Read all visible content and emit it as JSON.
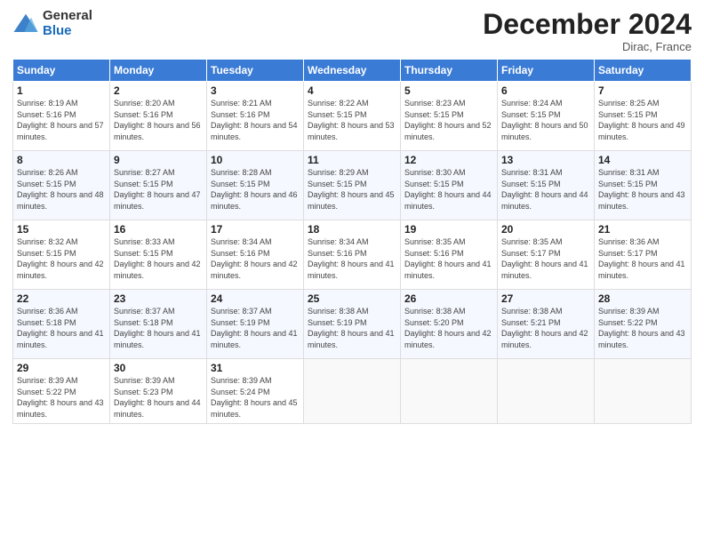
{
  "header": {
    "logo_general": "General",
    "logo_blue": "Blue",
    "month_title": "December 2024",
    "location": "Dirac, France"
  },
  "days_of_week": [
    "Sunday",
    "Monday",
    "Tuesday",
    "Wednesday",
    "Thursday",
    "Friday",
    "Saturday"
  ],
  "weeks": [
    [
      {
        "day": "1",
        "sunrise": "8:19 AM",
        "sunset": "5:16 PM",
        "daylight": "8 hours and 57 minutes."
      },
      {
        "day": "2",
        "sunrise": "8:20 AM",
        "sunset": "5:16 PM",
        "daylight": "8 hours and 56 minutes."
      },
      {
        "day": "3",
        "sunrise": "8:21 AM",
        "sunset": "5:16 PM",
        "daylight": "8 hours and 54 minutes."
      },
      {
        "day": "4",
        "sunrise": "8:22 AM",
        "sunset": "5:15 PM",
        "daylight": "8 hours and 53 minutes."
      },
      {
        "day": "5",
        "sunrise": "8:23 AM",
        "sunset": "5:15 PM",
        "daylight": "8 hours and 52 minutes."
      },
      {
        "day": "6",
        "sunrise": "8:24 AM",
        "sunset": "5:15 PM",
        "daylight": "8 hours and 50 minutes."
      },
      {
        "day": "7",
        "sunrise": "8:25 AM",
        "sunset": "5:15 PM",
        "daylight": "8 hours and 49 minutes."
      }
    ],
    [
      {
        "day": "8",
        "sunrise": "8:26 AM",
        "sunset": "5:15 PM",
        "daylight": "8 hours and 48 minutes."
      },
      {
        "day": "9",
        "sunrise": "8:27 AM",
        "sunset": "5:15 PM",
        "daylight": "8 hours and 47 minutes."
      },
      {
        "day": "10",
        "sunrise": "8:28 AM",
        "sunset": "5:15 PM",
        "daylight": "8 hours and 46 minutes."
      },
      {
        "day": "11",
        "sunrise": "8:29 AM",
        "sunset": "5:15 PM",
        "daylight": "8 hours and 45 minutes."
      },
      {
        "day": "12",
        "sunrise": "8:30 AM",
        "sunset": "5:15 PM",
        "daylight": "8 hours and 44 minutes."
      },
      {
        "day": "13",
        "sunrise": "8:31 AM",
        "sunset": "5:15 PM",
        "daylight": "8 hours and 44 minutes."
      },
      {
        "day": "14",
        "sunrise": "8:31 AM",
        "sunset": "5:15 PM",
        "daylight": "8 hours and 43 minutes."
      }
    ],
    [
      {
        "day": "15",
        "sunrise": "8:32 AM",
        "sunset": "5:15 PM",
        "daylight": "8 hours and 42 minutes."
      },
      {
        "day": "16",
        "sunrise": "8:33 AM",
        "sunset": "5:15 PM",
        "daylight": "8 hours and 42 minutes."
      },
      {
        "day": "17",
        "sunrise": "8:34 AM",
        "sunset": "5:16 PM",
        "daylight": "8 hours and 42 minutes."
      },
      {
        "day": "18",
        "sunrise": "8:34 AM",
        "sunset": "5:16 PM",
        "daylight": "8 hours and 41 minutes."
      },
      {
        "day": "19",
        "sunrise": "8:35 AM",
        "sunset": "5:16 PM",
        "daylight": "8 hours and 41 minutes."
      },
      {
        "day": "20",
        "sunrise": "8:35 AM",
        "sunset": "5:17 PM",
        "daylight": "8 hours and 41 minutes."
      },
      {
        "day": "21",
        "sunrise": "8:36 AM",
        "sunset": "5:17 PM",
        "daylight": "8 hours and 41 minutes."
      }
    ],
    [
      {
        "day": "22",
        "sunrise": "8:36 AM",
        "sunset": "5:18 PM",
        "daylight": "8 hours and 41 minutes."
      },
      {
        "day": "23",
        "sunrise": "8:37 AM",
        "sunset": "5:18 PM",
        "daylight": "8 hours and 41 minutes."
      },
      {
        "day": "24",
        "sunrise": "8:37 AM",
        "sunset": "5:19 PM",
        "daylight": "8 hours and 41 minutes."
      },
      {
        "day": "25",
        "sunrise": "8:38 AM",
        "sunset": "5:19 PM",
        "daylight": "8 hours and 41 minutes."
      },
      {
        "day": "26",
        "sunrise": "8:38 AM",
        "sunset": "5:20 PM",
        "daylight": "8 hours and 42 minutes."
      },
      {
        "day": "27",
        "sunrise": "8:38 AM",
        "sunset": "5:21 PM",
        "daylight": "8 hours and 42 minutes."
      },
      {
        "day": "28",
        "sunrise": "8:39 AM",
        "sunset": "5:22 PM",
        "daylight": "8 hours and 43 minutes."
      }
    ],
    [
      {
        "day": "29",
        "sunrise": "8:39 AM",
        "sunset": "5:22 PM",
        "daylight": "8 hours and 43 minutes."
      },
      {
        "day": "30",
        "sunrise": "8:39 AM",
        "sunset": "5:23 PM",
        "daylight": "8 hours and 44 minutes."
      },
      {
        "day": "31",
        "sunrise": "8:39 AM",
        "sunset": "5:24 PM",
        "daylight": "8 hours and 45 minutes."
      },
      null,
      null,
      null,
      null
    ]
  ]
}
